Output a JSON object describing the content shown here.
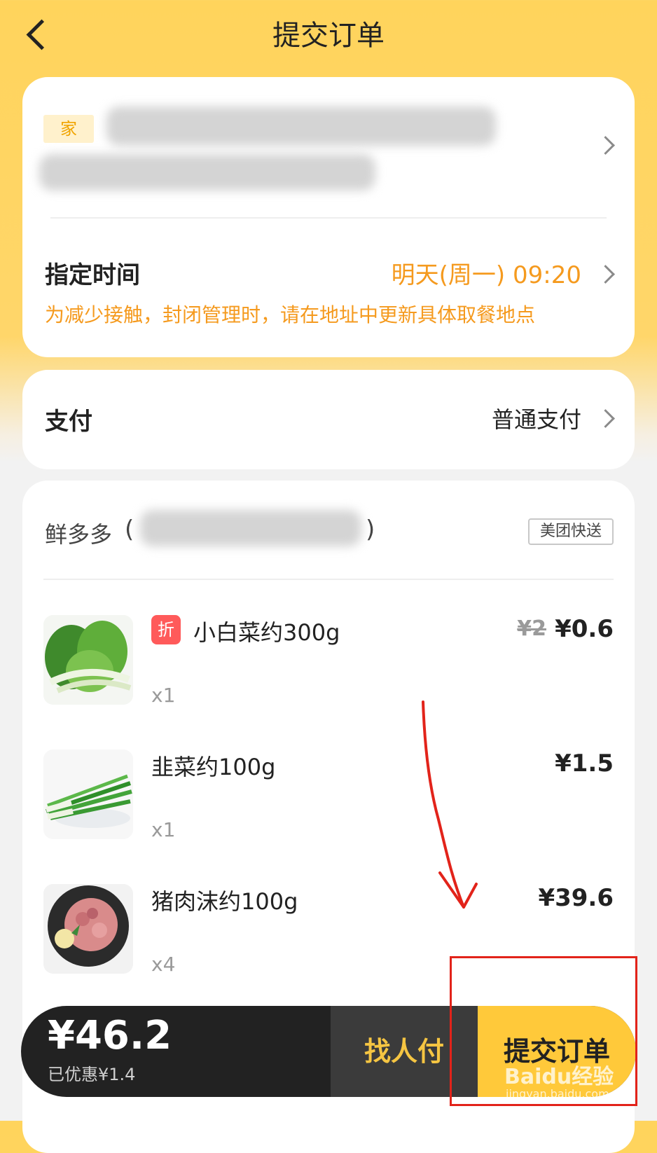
{
  "header": {
    "title": "提交订单"
  },
  "address": {
    "tag": "家"
  },
  "schedule": {
    "label": "指定时间",
    "value": "明天(周一) 09:20",
    "note": "为减少接触，封闭管理时，请在地址中更新具体取餐地点"
  },
  "payment": {
    "label": "支付",
    "value": "普通支付"
  },
  "shop": {
    "name": "鲜多多",
    "paren_open": "(",
    "paren_close": ")",
    "delivery_badge": "美团快送"
  },
  "items": [
    {
      "name": "小白菜约300g",
      "tag": "折",
      "qty": "x1",
      "original_price": "¥2",
      "price": "¥0.6",
      "image": "bok-choy"
    },
    {
      "name": "韭菜约100g",
      "qty": "x1",
      "price": "¥1.5",
      "image": "chives"
    },
    {
      "name": "猪肉沫约100g",
      "qty": "x4",
      "price": "¥39.6",
      "image": "minced-pork"
    }
  ],
  "footer": {
    "total": "¥46.2",
    "saved": "已优惠¥1.4",
    "find_pay_label": "找人付",
    "submit_label": "提交订单"
  },
  "watermark": {
    "text": "Baidu经验",
    "url": "jingyan.baidu.com"
  },
  "colors": {
    "brand_yellow": "#ffd45c",
    "accent_orange": "#f59a1e",
    "annotation_red": "#e2231a"
  }
}
